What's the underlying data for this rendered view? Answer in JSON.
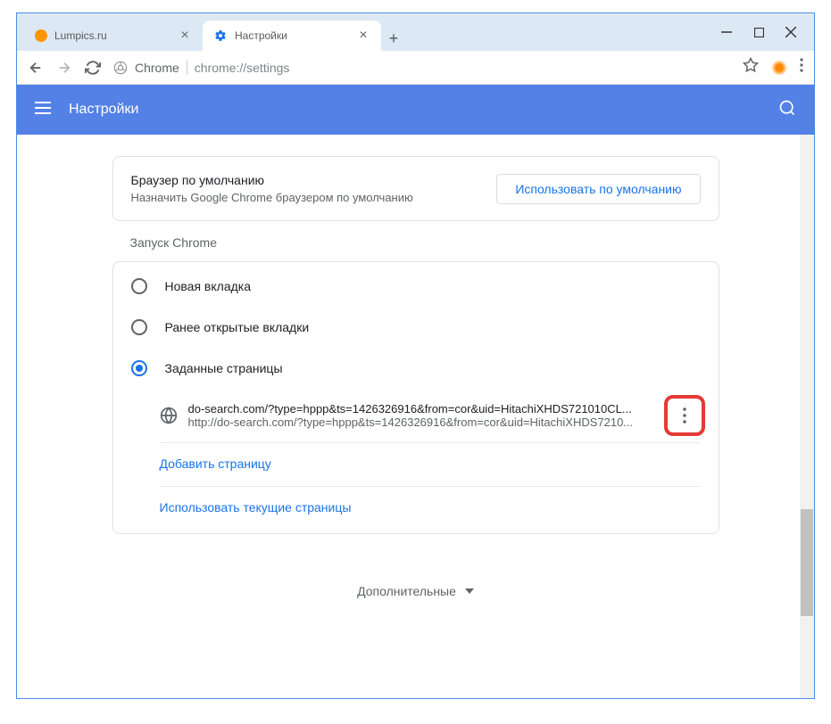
{
  "tabs": {
    "items": [
      {
        "title": "Lumpics.ru",
        "active": false
      },
      {
        "title": "Настройки",
        "active": true
      }
    ]
  },
  "addressBar": {
    "scheme": "Chrome",
    "url": "chrome://settings"
  },
  "settingsHeader": {
    "title": "Настройки"
  },
  "defaultBrowser": {
    "title": "Браузер по умолчанию",
    "subtitle": "Назначить Google Chrome браузером по умолчанию",
    "button": "Использовать по умолчанию"
  },
  "startup": {
    "sectionLabel": "Запуск Chrome",
    "options": {
      "newTab": "Новая вкладка",
      "prevOpen": "Ранее открытые вкладки",
      "specificPages": "Заданные страницы"
    },
    "page": {
      "title": "do-search.com/?type=hppp&ts=1426326916&from=cor&uid=HitachiXHDS721010CL...",
      "url": "http://do-search.com/?type=hppp&ts=1426326916&from=cor&uid=HitachiXHDS7210..."
    },
    "addPage": "Добавить страницу",
    "useCurrent": "Использовать текущие страницы"
  },
  "advanced": {
    "label": "Дополнительные"
  }
}
